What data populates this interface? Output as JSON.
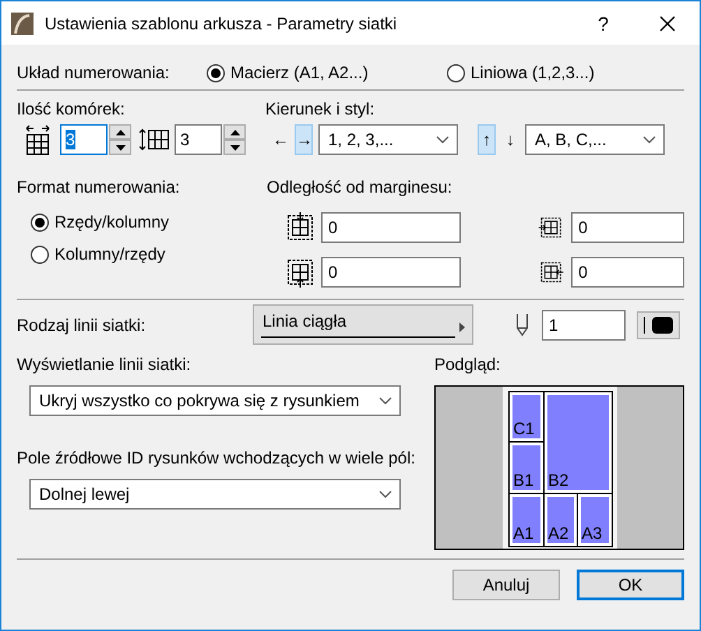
{
  "window": {
    "title": "Ustawienia szablonu arkusza - Parametry siatki",
    "help": "?"
  },
  "numbering_layout": {
    "label": "Układ numerowania:",
    "options": [
      {
        "label": "Macierz (A1, A2...)",
        "selected": true
      },
      {
        "label": "Liniowa (1,2,3...)",
        "selected": false
      }
    ]
  },
  "cell_count": {
    "label": "Ilość komórek:",
    "columns": {
      "value": "3",
      "focused": true
    },
    "rows": {
      "value": "3",
      "focused": false
    }
  },
  "direction_style": {
    "label": "Kierunek i styl:",
    "horizontal": {
      "arrows": [
        {
          "glyph": "←",
          "selected": false
        },
        {
          "glyph": "→",
          "selected": true
        }
      ],
      "style": "1, 2, 3,..."
    },
    "vertical": {
      "arrows": [
        {
          "glyph": "↑",
          "selected": true
        },
        {
          "glyph": "↓",
          "selected": false
        }
      ],
      "style": "A, B, C,..."
    }
  },
  "numbering_format": {
    "label": "Format numerowania:",
    "options": [
      {
        "label": "Rzędy/kolumny",
        "selected": true
      },
      {
        "label": "Kolumny/rzędy",
        "selected": false
      }
    ]
  },
  "margin_offset": {
    "label": "Odległość od marginesu:",
    "fields": [
      {
        "kind": "top",
        "value": "0"
      },
      {
        "kind": "left",
        "value": "0"
      },
      {
        "kind": "bottom",
        "value": "0"
      },
      {
        "kind": "right",
        "value": "0"
      }
    ]
  },
  "grid_line_type": {
    "label": "Rodzaj linii siatki:",
    "value": "Linia ciągła",
    "pen": "1"
  },
  "grid_line_display": {
    "label": "Wyświetlanie linii siatki:",
    "value": "Ukryj wszystko co pokrywa się z rysunkiem"
  },
  "preview": {
    "label": "Podgląd:",
    "cells": [
      {
        "label": "C1"
      },
      {
        "label": "B1"
      },
      {
        "label": "B2"
      },
      {
        "label": "A1"
      },
      {
        "label": "A2"
      },
      {
        "label": "A3"
      }
    ]
  },
  "source_field": {
    "label": "Pole źródłowe ID rysunków wchodzących w wiele pól:",
    "value": "Dolnej lewej"
  },
  "buttons": [
    {
      "label": "Anuluj",
      "default": false
    },
    {
      "label": "OK",
      "default": true
    }
  ]
}
